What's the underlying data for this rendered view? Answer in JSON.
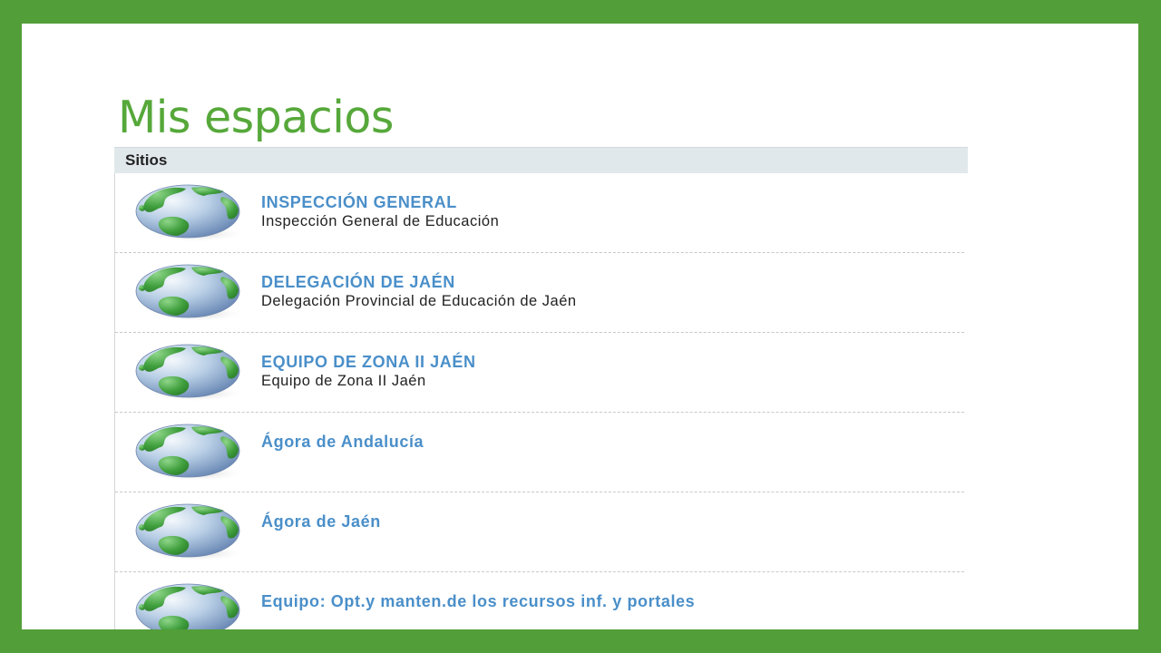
{
  "slide": {
    "title": "Mis espacios",
    "background_color": "#529e38",
    "title_color": "#56a83a"
  },
  "panel": {
    "header": "Sitios",
    "link_color": "#4a8fc9",
    "icon": "globe-icon",
    "sites": [
      {
        "name": "INSPECCIÓN GENERAL",
        "description": "Inspección General de Educación"
      },
      {
        "name": "DELEGACIÓN DE JAÉN",
        "description": "Delegación Provincial de Educación de Jaén"
      },
      {
        "name": "EQUIPO DE ZONA II JAÉN",
        "description": "Equipo de Zona II Jaén"
      },
      {
        "name": "Ágora de Andalucía",
        "description": ""
      },
      {
        "name": "Ágora de Jaén",
        "description": ""
      },
      {
        "name": "Equipo: Opt.y manten.de los recursos inf. y portales",
        "description": ""
      }
    ]
  }
}
